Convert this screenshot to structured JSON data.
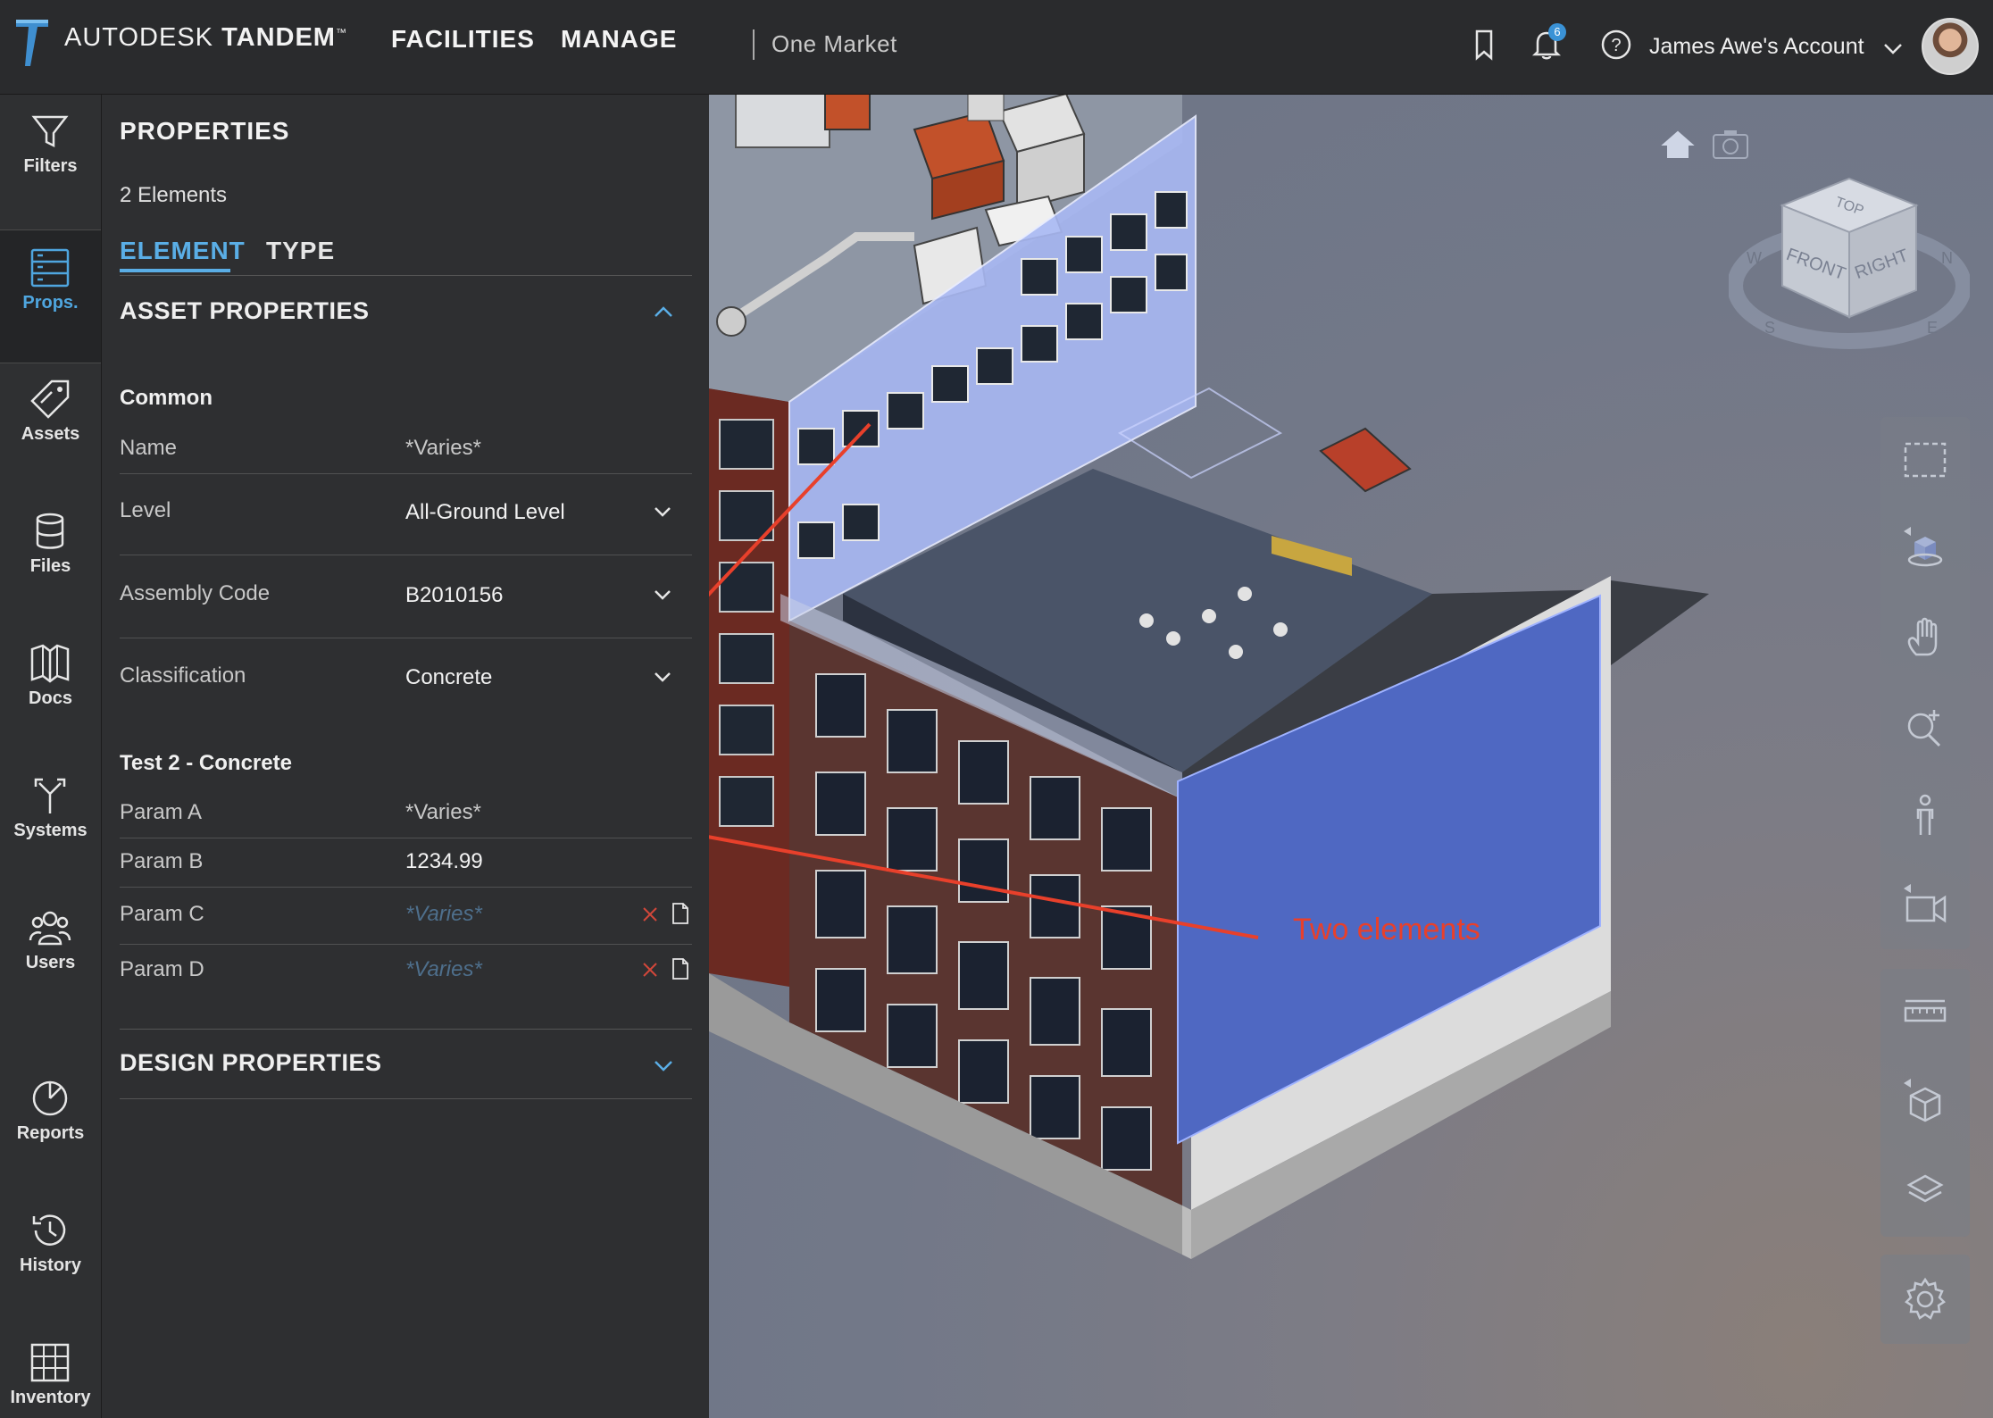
{
  "header": {
    "brand_light": "AUTODESK",
    "brand_bold": "TANDEM",
    "trademark": "™",
    "nav": [
      "FACILITIES",
      "MANAGE"
    ],
    "facility": "One Market",
    "notification_count": "6",
    "account": "James Awe's Account",
    "icons": [
      "bookmark-icon",
      "bell-icon",
      "help-icon",
      "chevron-down-icon"
    ]
  },
  "rail": {
    "items": [
      {
        "label": "Filters",
        "icon": "filter-icon"
      },
      {
        "label": "Props.",
        "icon": "properties-icon",
        "active": true
      },
      {
        "label": "Assets",
        "icon": "tag-icon"
      },
      {
        "label": "Files",
        "icon": "database-icon"
      },
      {
        "label": "Docs",
        "icon": "book-icon"
      },
      {
        "label": "Systems",
        "icon": "systems-icon"
      },
      {
        "label": "Users",
        "icon": "users-icon"
      },
      {
        "label": "Reports",
        "icon": "pie-chart-icon"
      },
      {
        "label": "History",
        "icon": "history-icon"
      },
      {
        "label": "Inventory",
        "icon": "grid-table-icon"
      }
    ]
  },
  "panel": {
    "title": "PROPERTIES",
    "count": "2 Elements",
    "tabs": [
      "ELEMENT",
      "TYPE"
    ],
    "asset_section": "ASSET PROPERTIES",
    "common_group": "Common",
    "common_rows": [
      {
        "key": "Name",
        "value": "*Varies*"
      },
      {
        "key": "Level",
        "value": "All-Ground Level"
      },
      {
        "key": "Assembly Code",
        "value": "B2010156"
      },
      {
        "key": "Classification",
        "value": "Concrete"
      }
    ],
    "test_group": "Test 2 - Concrete",
    "test_rows": [
      {
        "key": "Param A",
        "value": "*Varies*"
      },
      {
        "key": "Param B",
        "value": "1234.99"
      },
      {
        "key": "Param C",
        "value": "*Varies*"
      },
      {
        "key": "Param D",
        "value": "*Varies*"
      }
    ],
    "design_section": "DESIGN PROPERTIES"
  },
  "viewport": {
    "annotation": "Two elements",
    "viewcube": {
      "top": "TOP",
      "front": "FRONT",
      "right": "RIGHT",
      "compass": [
        "W",
        "N",
        "S",
        "E"
      ]
    },
    "tools": [
      "box-select-icon",
      "orbit-icon",
      "pan-hand-icon",
      "zoom-icon",
      "walk-person-icon",
      "camera-video-icon",
      "measure-icon",
      "section-box-icon",
      "layers-icon",
      "settings-gear-icon"
    ]
  },
  "colors": {
    "accent": "#5aaee6",
    "annotation": "#e8402b",
    "selection": "#5066c8"
  }
}
